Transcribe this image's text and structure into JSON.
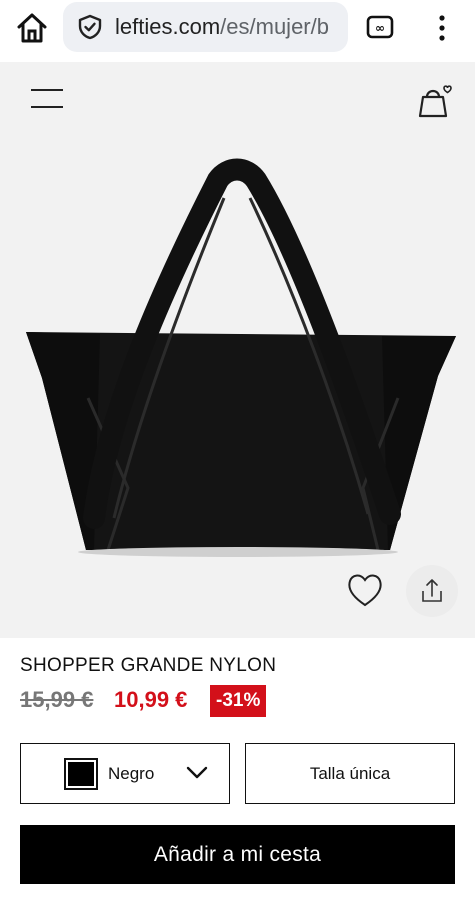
{
  "browser": {
    "url_main": "lefties.com",
    "url_path": "/es/mujer/b",
    "home_icon": "home-icon",
    "shield_icon": "shield-icon",
    "tabs_icon": "tab-switcher-icon",
    "menu_icon": "more-vert-icon"
  },
  "header": {
    "menu_icon": "hamburger-menu-icon",
    "cart_icon": "shopping-bag-heart-icon"
  },
  "product": {
    "image": "black nylon tote bag",
    "name": "SHOPPER GRANDE NYLON",
    "old_price": "15,99 €",
    "new_price": "10,99 €",
    "discount": "-31%",
    "favorite_icon": "heart-icon",
    "share_icon": "share-icon"
  },
  "options": {
    "color_label": "Negro",
    "color_value": "#000000",
    "size_label": "Talla única"
  },
  "actions": {
    "add_to_cart": "Añadir a mi cesta"
  },
  "colors": {
    "sale_red": "#d3101a",
    "hero_bg": "#f2f2f2",
    "url_bar_bg": "#eef0f4"
  }
}
